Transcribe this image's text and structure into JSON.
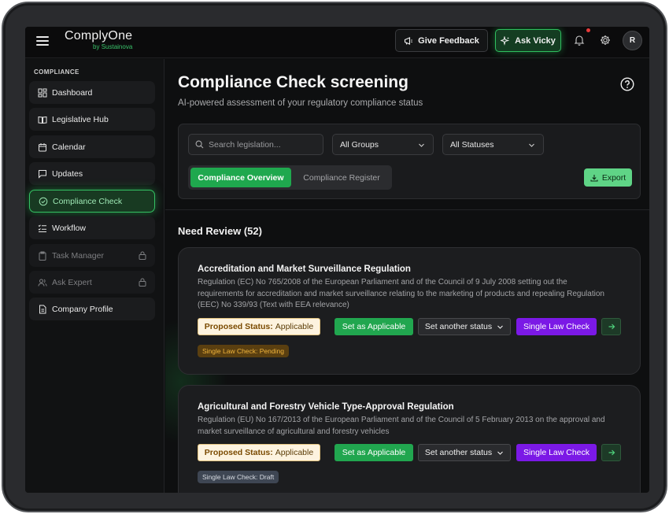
{
  "app": {
    "title": "ComplyOne",
    "subtitle": "by Sustainova"
  },
  "topbar": {
    "feedback_label": "Give Feedback",
    "vicky_label": "Ask Vicky",
    "avatar_initial": "R"
  },
  "sidebar": {
    "heading": "COMPLIANCE",
    "items": [
      {
        "label": "Dashboard"
      },
      {
        "label": "Legislative Hub"
      },
      {
        "label": "Calendar"
      },
      {
        "label": "Updates"
      },
      {
        "label": "Compliance Check"
      },
      {
        "label": "Workflow"
      },
      {
        "label": "Task Manager"
      },
      {
        "label": "Ask Expert"
      },
      {
        "label": "Company Profile"
      }
    ]
  },
  "header": {
    "title": "Compliance Check screening",
    "subtitle": "AI-powered assessment of your regulatory compliance status"
  },
  "filters": {
    "search_placeholder": "Search legislation...",
    "groups_value": "All Groups",
    "statuses_value": "All Statuses"
  },
  "tabs": {
    "overview": "Compliance Overview",
    "register": "Compliance Register"
  },
  "export_label": "Export",
  "section": {
    "title": "Need Review (52)"
  },
  "cards": [
    {
      "title": "Accreditation and Market Surveillance Regulation",
      "description": "Regulation (EC) No 765/2008 of the European Parliament and of the Council of 9 July 2008 setting out the requirements for accreditation and market surveillance relating to the marketing of products and repealing Regulation (EEC) No 339/93 (Text with EEA relevance)",
      "proposed_prefix": "Proposed Status:",
      "proposed_value": "Applicable",
      "set_applicable": "Set as Applicable",
      "set_another": "Set another status",
      "single_law": "Single Law Check",
      "pill": "Single Law Check: Pending"
    },
    {
      "title": "Agricultural and Forestry Vehicle Type-Approval Regulation",
      "description": "Regulation (EU) No 167/2013 of the European Parliament and of the Council of 5 February 2013 on the approval and market surveillance of agricultural and forestry vehicles",
      "proposed_prefix": "Proposed Status:",
      "proposed_value": "Applicable",
      "set_applicable": "Set as Applicable",
      "set_another": "Set another status",
      "single_law": "Single Law Check",
      "pill": "Single Law Check: Draft"
    }
  ],
  "colors": {
    "accent_green": "#21a64f",
    "purple": "#7b19e6",
    "background": "#0e0f10",
    "pending_pill": "#5a3f10",
    "draft_pill": "#3e4653"
  }
}
